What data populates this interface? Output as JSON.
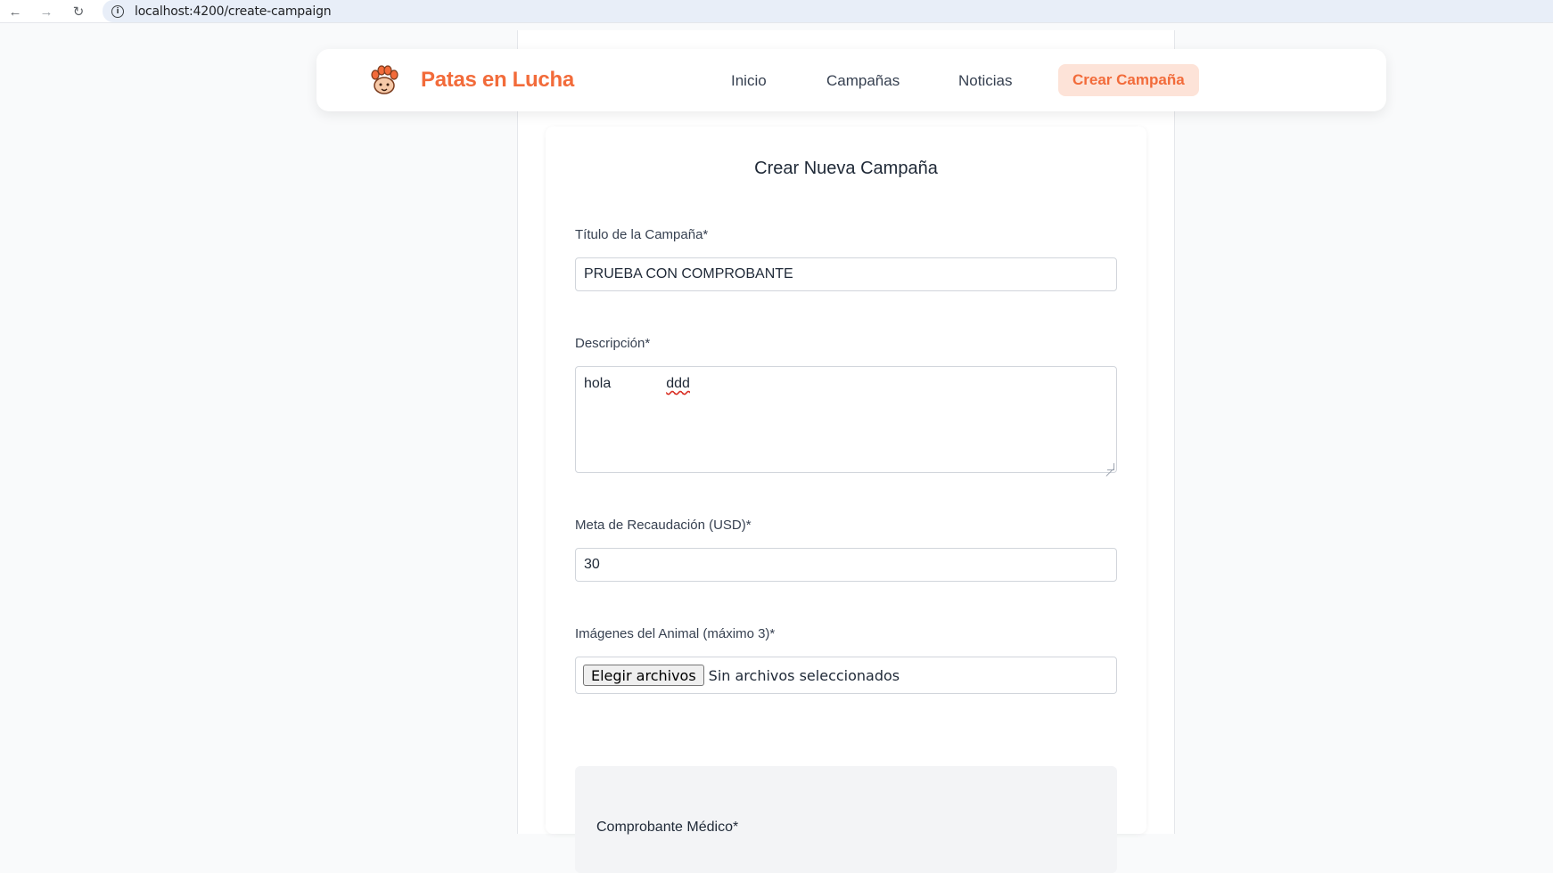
{
  "browser": {
    "url": "localhost:4200/create-campaign"
  },
  "header": {
    "brand": "Patas en Lucha",
    "nav": {
      "inicio": "Inicio",
      "campanas": "Campañas",
      "noticias": "Noticias",
      "crear": "Crear Campaña"
    }
  },
  "form": {
    "title": "Crear Nueva Campaña",
    "campaign_title": {
      "label": "Título de la Campaña*",
      "value": "PRUEBA CON COMPROBANTE"
    },
    "description": {
      "label": "Descripción*",
      "value_part1": "hola",
      "value_part2": "ddd"
    },
    "goal": {
      "label": "Meta de Recaudación (USD)*",
      "value": "30"
    },
    "images": {
      "label": "Imágenes del Animal (máximo 3)*",
      "button": "Elegir archivos",
      "status": "Sin archivos seleccionados"
    },
    "proof": {
      "label": "Comprobante Médico*"
    }
  },
  "colors": {
    "brand": "#f26b3a",
    "active_nav_bg": "#fde3d8"
  }
}
